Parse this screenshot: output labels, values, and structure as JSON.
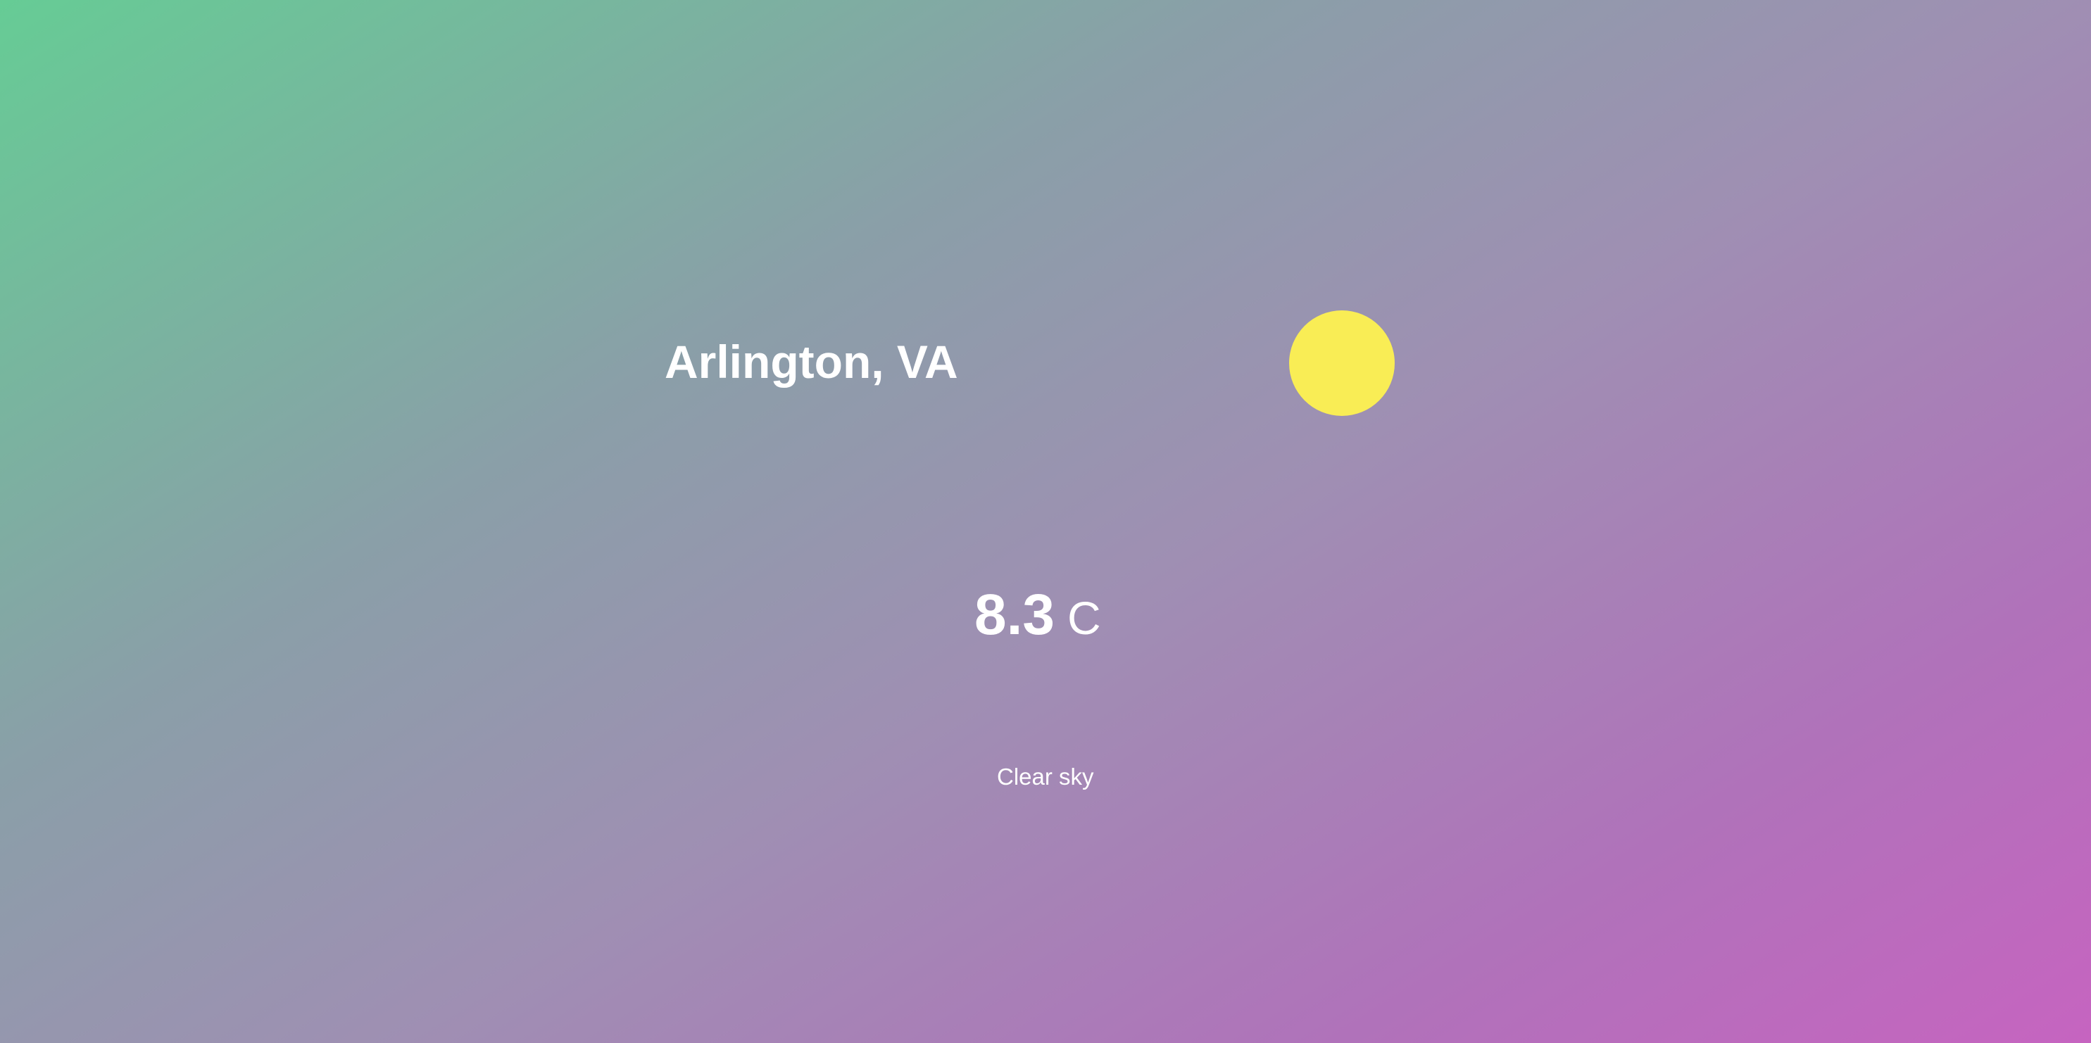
{
  "weather": {
    "location": "Arlington, VA",
    "icon": "sun-icon",
    "temperature": "8.3",
    "unit": "C",
    "condition": "Clear sky"
  },
  "colors": {
    "gradient_start": "#66cc95",
    "gradient_end": "#c664c0",
    "sun": "#f9ed55",
    "text": "#ffffff"
  }
}
